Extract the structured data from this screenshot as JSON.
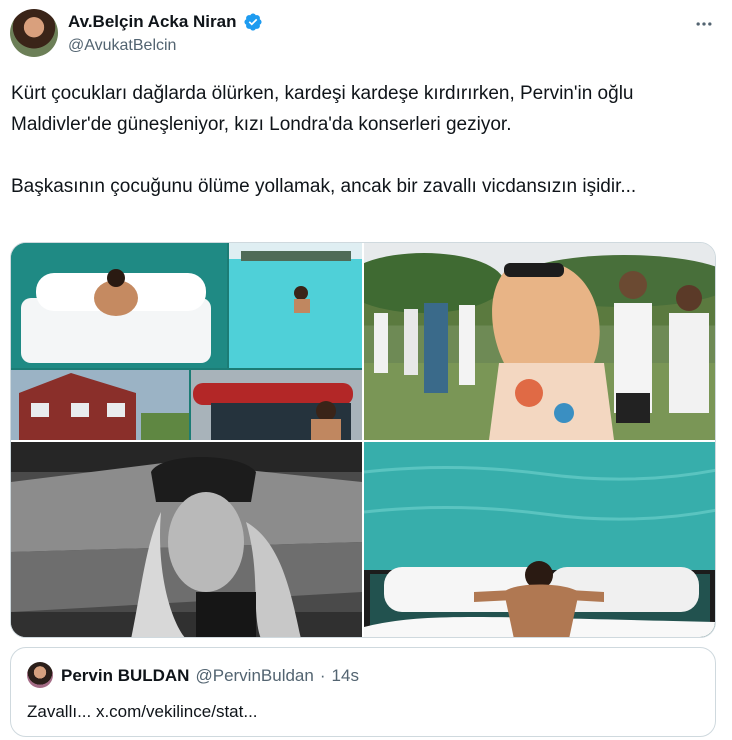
{
  "author": {
    "display_name": "Av.Belçin Acka Niran",
    "handle": "@AvukatBelcin",
    "verified_icon": "verified-badge-icon",
    "verified_color": "#1d9bf0"
  },
  "post": {
    "paragraph_1": "Kürt çocukları dağlarda ölürken, kardeşi kardeşe kırdırırken, Pervin'in oğlu Maldivler'de güneşleniyor, kızı Londra'da konserleri geziyor.",
    "paragraph_2": "Başkasının çocuğunu ölüme yollamak, ancak bir zavallı vicdansızın işidir..."
  },
  "media": {
    "photos": [
      {
        "subject": "photo-collage-bed-pool-car"
      },
      {
        "subject": "photo-festival-woman-color"
      },
      {
        "subject": "photo-stadium-woman-headdress"
      },
      {
        "subject": "photo-man-on-floating-bed"
      }
    ]
  },
  "quoted_post": {
    "display_name": "Pervin BULDAN",
    "handle": "@PervinBuldan",
    "separator": "·",
    "time": "14s",
    "text": "Zavallı... x.com/vekilince/stat..."
  },
  "colors": {
    "text_primary": "#0f1419",
    "text_secondary": "#536471",
    "border": "#cfd9de",
    "accent": "#1d9bf0"
  }
}
